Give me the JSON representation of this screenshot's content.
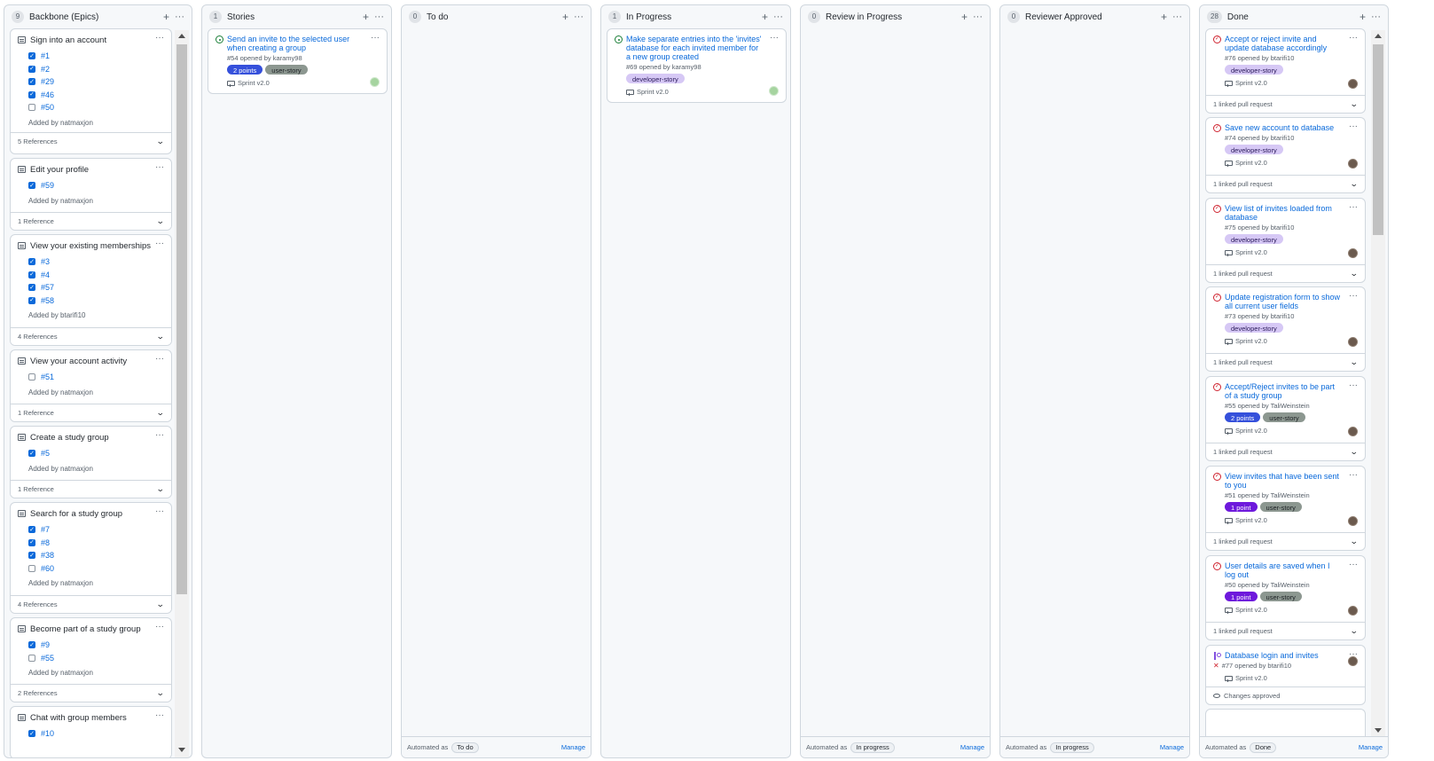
{
  "board": {
    "columns": [
      {
        "count": "9",
        "title": "Backbone (Epics)",
        "notes": [
          {
            "title": "Sign into an account",
            "items": [
              {
                "num": "#1",
                "checked": true
              },
              {
                "num": "#2",
                "checked": true
              },
              {
                "num": "#29",
                "checked": true
              },
              {
                "num": "#46",
                "checked": true
              },
              {
                "num": "#50",
                "checked": false
              }
            ],
            "added": "Added by natmaxjon",
            "refs": "5 References"
          },
          {
            "title": "Edit your profile",
            "items": [
              {
                "num": "#59",
                "checked": true
              }
            ],
            "added": "Added by natmaxjon",
            "refs": "1 Reference"
          },
          {
            "title": "View your existing memberships",
            "items": [
              {
                "num": "#3",
                "checked": true
              },
              {
                "num": "#4",
                "checked": true
              },
              {
                "num": "#57",
                "checked": true
              },
              {
                "num": "#58",
                "checked": true
              }
            ],
            "added": "Added by btarifi10",
            "refs": "4 References"
          },
          {
            "title": "View your account activity",
            "items": [
              {
                "num": "#51",
                "checked": false
              }
            ],
            "added": "Added by natmaxjon",
            "refs": "1 Reference"
          },
          {
            "title": "Create a study group",
            "items": [
              {
                "num": "#5",
                "checked": true
              }
            ],
            "added": "Added by natmaxjon",
            "refs": "1 Reference"
          },
          {
            "title": "Search for a study group",
            "items": [
              {
                "num": "#7",
                "checked": true
              },
              {
                "num": "#8",
                "checked": true
              },
              {
                "num": "#38",
                "checked": true
              },
              {
                "num": "#60",
                "checked": false
              }
            ],
            "added": "Added by natmaxjon",
            "refs": "4 References"
          },
          {
            "title": "Become part of a study group",
            "items": [
              {
                "num": "#9",
                "checked": true
              },
              {
                "num": "#55",
                "checked": false
              }
            ],
            "added": "Added by natmaxjon",
            "refs": "2 References"
          },
          {
            "title": "Chat with group members",
            "items": [
              {
                "num": "#10",
                "checked": true
              }
            ],
            "added": "",
            "refs": ""
          }
        ]
      },
      {
        "count": "1",
        "title": "Stories",
        "cards": [
          {
            "title": "Send an invite to the selected user when creating a group",
            "meta": "#54 opened by karamy98",
            "labels": [
              {
                "text": "2 points",
                "kind": "points"
              },
              {
                "text": "user-story",
                "kind": "us"
              }
            ],
            "sprint": "Sprint v2.0"
          }
        ]
      },
      {
        "count": "0",
        "title": "To do",
        "automated": "Automated as",
        "auto_value": "To do",
        "manage": "Manage"
      },
      {
        "count": "1",
        "title": "In Progress",
        "cards": [
          {
            "title": "Make separate entries into the 'invites' database for each invited member for a new group created",
            "meta": "#69 opened by karamy98",
            "labels": [
              {
                "text": "developer-story",
                "kind": "dev"
              }
            ],
            "sprint": "Sprint v2.0"
          }
        ]
      },
      {
        "count": "0",
        "title": "Review in Progress",
        "automated": "Automated as",
        "auto_value": "In progress",
        "manage": "Manage"
      },
      {
        "count": "0",
        "title": "Reviewer Approved",
        "automated": "Automated as",
        "auto_value": "In progress",
        "manage": "Manage"
      },
      {
        "count": "28",
        "title": "Done",
        "automated": "Automated as",
        "auto_value": "Done",
        "manage": "Manage",
        "cards": [
          {
            "title": "Accept or reject invite and update database accordingly",
            "meta": "#76 opened by btarifi10",
            "labels": [
              {
                "text": "developer-story",
                "kind": "dev"
              }
            ],
            "sprint": "Sprint v2.0",
            "linked": "1 linked pull request"
          },
          {
            "title": "Save new account to database",
            "meta": "#74 opened by btarifi10",
            "labels": [
              {
                "text": "developer-story",
                "kind": "dev"
              }
            ],
            "sprint": "Sprint v2.0",
            "linked": "1 linked pull request"
          },
          {
            "title": "View list of invites loaded from database",
            "meta": "#75 opened by btarifi10",
            "labels": [
              {
                "text": "developer-story",
                "kind": "dev"
              }
            ],
            "sprint": "Sprint v2.0",
            "linked": "1 linked pull request"
          },
          {
            "title": "Update registration form to show all current user fields",
            "meta": "#73 opened by btarifi10",
            "labels": [
              {
                "text": "developer-story",
                "kind": "dev"
              }
            ],
            "sprint": "Sprint v2.0",
            "linked": "1 linked pull request"
          },
          {
            "title": "Accept/Reject invites to be part of a study group",
            "meta": "#55 opened by TaliWeinstein",
            "labels": [
              {
                "text": "2 points",
                "kind": "points"
              },
              {
                "text": "user-story",
                "kind": "us"
              }
            ],
            "sprint": "Sprint v2.0",
            "linked": "1 linked pull request"
          },
          {
            "title": "View invites that have been sent to you",
            "meta": "#51 opened by TaliWeinstein",
            "labels": [
              {
                "text": "1 point",
                "kind": "point1"
              },
              {
                "text": "user-story",
                "kind": "us"
              }
            ],
            "sprint": "Sprint v2.0",
            "linked": "1 linked pull request"
          },
          {
            "title": "User details are saved when I log out",
            "meta": "#50 opened by TaliWeinstein",
            "labels": [
              {
                "text": "1 point",
                "kind": "point1"
              },
              {
                "text": "user-story",
                "kind": "us"
              }
            ],
            "sprint": "Sprint v2.0",
            "linked": "1 linked pull request"
          },
          {
            "title": "Database login and invites",
            "meta": "#77 opened by btarifi10",
            "sprint": "Sprint v2.0",
            "linked": "Changes approved"
          }
        ]
      }
    ]
  }
}
